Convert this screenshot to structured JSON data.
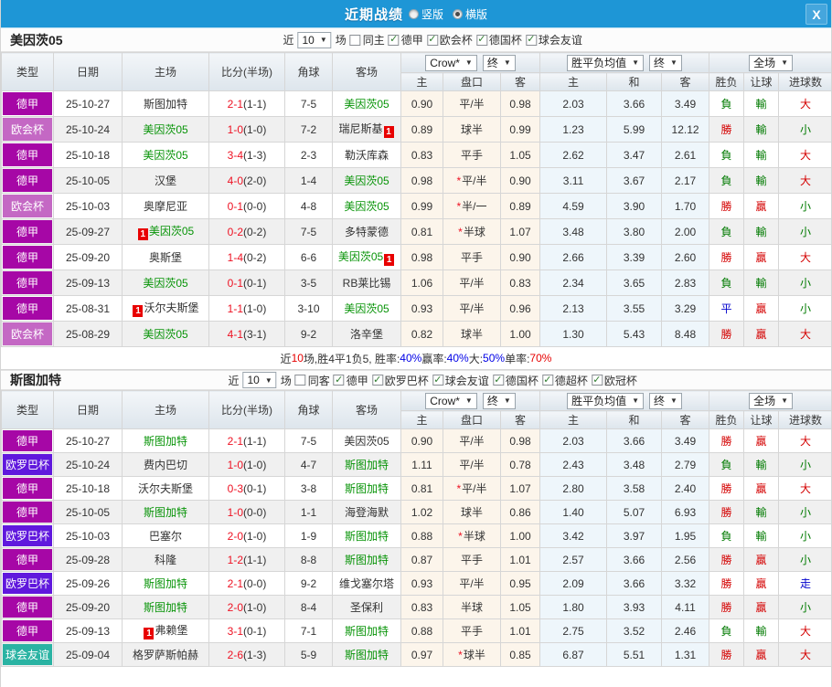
{
  "topbar": {
    "title": "近期战绩",
    "radios": [
      {
        "label": "竖版",
        "selected": false
      },
      {
        "label": "横版",
        "selected": true
      }
    ],
    "close_label": "X"
  },
  "table_headers": {
    "cols": [
      "类型",
      "日期",
      "主场",
      "比分(半场)",
      "角球",
      "客场"
    ],
    "sub": [
      "主",
      "盘口",
      "客",
      "主",
      "和",
      "客",
      "胜负",
      "让球",
      "进球数"
    ],
    "selects": {
      "asian": [
        "Crow*",
        "终"
      ],
      "euro": [
        "胜平负均值",
        "终"
      ],
      "scope": [
        "全场"
      ]
    }
  },
  "league_colors": {
    "德甲": "#a607a6",
    "欧会杯": "#c468c4",
    "欧罗巴杯": "#6018dd",
    "球会友谊": "#2ab3a3"
  },
  "result_colors": {
    "r": "#d40000",
    "g": "#007a00",
    "b": "#0000cc"
  },
  "accent_colors": {
    "topbar_blue": "#1e96d6",
    "score_red": "#ee1122",
    "team_green": "#089408"
  },
  "sections": [
    {
      "team": "美因茨05",
      "filter": {
        "near": "近",
        "count": "10",
        "unit": "场",
        "same": {
          "label": "同主",
          "checked": false
        },
        "leagues": [
          {
            "label": "德甲",
            "checked": true
          },
          {
            "label": "欧会杯",
            "checked": true
          },
          {
            "label": "德国杯",
            "checked": true
          },
          {
            "label": "球会友谊",
            "checked": true
          }
        ]
      },
      "rows": [
        {
          "league": "德甲",
          "date": "25-10-27",
          "home": "斯图加特",
          "home_green": false,
          "home_card": false,
          "score": "2-1",
          "half": "1-1",
          "corners": "7-5",
          "away": "美因茨05",
          "away_green": true,
          "away_card": false,
          "asian": [
            "0.90",
            "平/半",
            "0.98"
          ],
          "star": false,
          "euro": [
            "2.03",
            "3.66",
            "3.49"
          ],
          "wdl": [
            "負",
            "g"
          ],
          "hcp": [
            "輸",
            "g"
          ],
          "size": [
            "大",
            "r"
          ]
        },
        {
          "league": "欧会杯",
          "date": "25-10-24",
          "home": "美因茨05",
          "home_green": true,
          "home_card": false,
          "score": "1-0",
          "half": "1-0",
          "corners": "7-2",
          "away": "瑞尼斯基",
          "away_green": false,
          "away_card": true,
          "asian": [
            "0.89",
            "球半",
            "0.99"
          ],
          "star": false,
          "euro": [
            "1.23",
            "5.99",
            "12.12"
          ],
          "wdl": [
            "勝",
            "r"
          ],
          "hcp": [
            "輸",
            "g"
          ],
          "size": [
            "小",
            "g"
          ]
        },
        {
          "league": "德甲",
          "date": "25-10-18",
          "home": "美因茨05",
          "home_green": true,
          "home_card": false,
          "score": "3-4",
          "half": "1-3",
          "corners": "2-3",
          "away": "勒沃库森",
          "away_green": false,
          "away_card": false,
          "asian": [
            "0.83",
            "平手",
            "1.05"
          ],
          "star": false,
          "euro": [
            "2.62",
            "3.47",
            "2.61"
          ],
          "wdl": [
            "負",
            "g"
          ],
          "hcp": [
            "輸",
            "g"
          ],
          "size": [
            "大",
            "r"
          ]
        },
        {
          "league": "德甲",
          "date": "25-10-05",
          "home": "汉堡",
          "home_green": false,
          "home_card": false,
          "score": "4-0",
          "half": "2-0",
          "corners": "1-4",
          "away": "美因茨05",
          "away_green": true,
          "away_card": false,
          "asian": [
            "0.98",
            "平/半",
            "0.90"
          ],
          "star": true,
          "euro": [
            "3.11",
            "3.67",
            "2.17"
          ],
          "wdl": [
            "負",
            "g"
          ],
          "hcp": [
            "輸",
            "g"
          ],
          "size": [
            "大",
            "r"
          ]
        },
        {
          "league": "欧会杯",
          "date": "25-10-03",
          "home": "奥摩尼亚",
          "home_green": false,
          "home_card": false,
          "score": "0-1",
          "half": "0-0",
          "corners": "4-8",
          "away": "美因茨05",
          "away_green": true,
          "away_card": false,
          "asian": [
            "0.99",
            "半/一",
            "0.89"
          ],
          "star": true,
          "euro": [
            "4.59",
            "3.90",
            "1.70"
          ],
          "wdl": [
            "勝",
            "r"
          ],
          "hcp": [
            "贏",
            "r"
          ],
          "size": [
            "小",
            "g"
          ]
        },
        {
          "league": "德甲",
          "date": "25-09-27",
          "home": "美因茨05",
          "home_green": true,
          "home_card": true,
          "score": "0-2",
          "half": "0-2",
          "corners": "7-5",
          "away": "多特蒙德",
          "away_green": false,
          "away_card": false,
          "asian": [
            "0.81",
            "半球",
            "1.07"
          ],
          "star": true,
          "euro": [
            "3.48",
            "3.80",
            "2.00"
          ],
          "wdl": [
            "負",
            "g"
          ],
          "hcp": [
            "輸",
            "g"
          ],
          "size": [
            "小",
            "g"
          ]
        },
        {
          "league": "德甲",
          "date": "25-09-20",
          "home": "奥斯堡",
          "home_green": false,
          "home_card": false,
          "score": "1-4",
          "half": "0-2",
          "corners": "6-6",
          "away": "美因茨05",
          "away_green": true,
          "away_card": true,
          "asian": [
            "0.98",
            "平手",
            "0.90"
          ],
          "star": false,
          "euro": [
            "2.66",
            "3.39",
            "2.60"
          ],
          "wdl": [
            "勝",
            "r"
          ],
          "hcp": [
            "贏",
            "r"
          ],
          "size": [
            "大",
            "r"
          ]
        },
        {
          "league": "德甲",
          "date": "25-09-13",
          "home": "美因茨05",
          "home_green": true,
          "home_card": false,
          "score": "0-1",
          "half": "0-1",
          "corners": "3-5",
          "away": "RB莱比锡",
          "away_green": false,
          "away_card": false,
          "asian": [
            "1.06",
            "平/半",
            "0.83"
          ],
          "star": false,
          "euro": [
            "2.34",
            "3.65",
            "2.83"
          ],
          "wdl": [
            "負",
            "g"
          ],
          "hcp": [
            "輸",
            "g"
          ],
          "size": [
            "小",
            "g"
          ]
        },
        {
          "league": "德甲",
          "date": "25-08-31",
          "home": "沃尔夫斯堡",
          "home_green": false,
          "home_card": true,
          "score": "1-1",
          "half": "1-0",
          "corners": "3-10",
          "away": "美因茨05",
          "away_green": true,
          "away_card": false,
          "asian": [
            "0.93",
            "平/半",
            "0.96"
          ],
          "star": false,
          "euro": [
            "2.13",
            "3.55",
            "3.29"
          ],
          "wdl": [
            "平",
            "b"
          ],
          "hcp": [
            "贏",
            "r"
          ],
          "size": [
            "小",
            "g"
          ]
        },
        {
          "league": "欧会杯",
          "date": "25-08-29",
          "home": "美因茨05",
          "home_green": true,
          "home_card": false,
          "score": "4-1",
          "half": "3-1",
          "corners": "9-2",
          "away": "洛辛堡",
          "away_green": false,
          "away_card": false,
          "asian": [
            "0.82",
            "球半",
            "1.00"
          ],
          "star": false,
          "euro": [
            "1.30",
            "5.43",
            "8.48"
          ],
          "wdl": [
            "勝",
            "r"
          ],
          "hcp": [
            "贏",
            "r"
          ],
          "size": [
            "大",
            "r"
          ]
        }
      ],
      "summary": [
        {
          "text": "近",
          "color": "#333333"
        },
        {
          "text": "10",
          "color": "#e60000"
        },
        {
          "text": "场,胜4平1负5, 胜率:",
          "color": "#333333"
        },
        {
          "text": "40%",
          "color": "#0000e6"
        },
        {
          "text": " 赢率:",
          "color": "#333333"
        },
        {
          "text": "40%",
          "color": "#0000e6"
        },
        {
          "text": " 大:",
          "color": "#333333"
        },
        {
          "text": "50%",
          "color": "#0000e6"
        },
        {
          "text": " 单率:",
          "color": "#333333"
        },
        {
          "text": "70%",
          "color": "#e60000"
        }
      ]
    },
    {
      "team": "斯图加特",
      "filter": {
        "near": "近",
        "count": "10",
        "unit": "场",
        "same": {
          "label": "同客",
          "checked": false
        },
        "leagues": [
          {
            "label": "德甲",
            "checked": true
          },
          {
            "label": "欧罗巴杯",
            "checked": true
          },
          {
            "label": "球会友谊",
            "checked": true
          },
          {
            "label": "德国杯",
            "checked": true
          },
          {
            "label": "德超杯",
            "checked": true
          },
          {
            "label": "欧冠杯",
            "checked": true
          }
        ]
      },
      "rows": [
        {
          "league": "德甲",
          "date": "25-10-27",
          "home": "斯图加特",
          "home_green": true,
          "home_card": false,
          "score": "2-1",
          "half": "1-1",
          "corners": "7-5",
          "away": "美因茨05",
          "away_green": false,
          "away_card": false,
          "asian": [
            "0.90",
            "平/半",
            "0.98"
          ],
          "star": false,
          "euro": [
            "2.03",
            "3.66",
            "3.49"
          ],
          "wdl": [
            "勝",
            "r"
          ],
          "hcp": [
            "贏",
            "r"
          ],
          "size": [
            "大",
            "r"
          ]
        },
        {
          "league": "欧罗巴杯",
          "date": "25-10-24",
          "home": "费内巴切",
          "home_green": false,
          "home_card": false,
          "score": "1-0",
          "half": "1-0",
          "corners": "4-7",
          "away": "斯图加特",
          "away_green": true,
          "away_card": false,
          "asian": [
            "1.11",
            "平/半",
            "0.78"
          ],
          "star": false,
          "euro": [
            "2.43",
            "3.48",
            "2.79"
          ],
          "wdl": [
            "負",
            "g"
          ],
          "hcp": [
            "輸",
            "g"
          ],
          "size": [
            "小",
            "g"
          ]
        },
        {
          "league": "德甲",
          "date": "25-10-18",
          "home": "沃尔夫斯堡",
          "home_green": false,
          "home_card": false,
          "score": "0-3",
          "half": "0-1",
          "corners": "3-8",
          "away": "斯图加特",
          "away_green": true,
          "away_card": false,
          "asian": [
            "0.81",
            "平/半",
            "1.07"
          ],
          "star": true,
          "euro": [
            "2.80",
            "3.58",
            "2.40"
          ],
          "wdl": [
            "勝",
            "r"
          ],
          "hcp": [
            "贏",
            "r"
          ],
          "size": [
            "大",
            "r"
          ]
        },
        {
          "league": "德甲",
          "date": "25-10-05",
          "home": "斯图加特",
          "home_green": true,
          "home_card": false,
          "score": "1-0",
          "half": "0-0",
          "corners": "1-1",
          "away": "海登海默",
          "away_green": false,
          "away_card": false,
          "asian": [
            "1.02",
            "球半",
            "0.86"
          ],
          "star": false,
          "euro": [
            "1.40",
            "5.07",
            "6.93"
          ],
          "wdl": [
            "勝",
            "r"
          ],
          "hcp": [
            "輸",
            "g"
          ],
          "size": [
            "小",
            "g"
          ]
        },
        {
          "league": "欧罗巴杯",
          "date": "25-10-03",
          "home": "巴塞尔",
          "home_green": false,
          "home_card": false,
          "score": "2-0",
          "half": "1-0",
          "corners": "1-9",
          "away": "斯图加特",
          "away_green": true,
          "away_card": false,
          "asian": [
            "0.88",
            "半球",
            "1.00"
          ],
          "star": true,
          "euro": [
            "3.42",
            "3.97",
            "1.95"
          ],
          "wdl": [
            "負",
            "g"
          ],
          "hcp": [
            "輸",
            "g"
          ],
          "size": [
            "小",
            "g"
          ]
        },
        {
          "league": "德甲",
          "date": "25-09-28",
          "home": "科隆",
          "home_green": false,
          "home_card": false,
          "score": "1-2",
          "half": "1-1",
          "corners": "8-8",
          "away": "斯图加特",
          "away_green": true,
          "away_card": false,
          "asian": [
            "0.87",
            "平手",
            "1.01"
          ],
          "star": false,
          "euro": [
            "2.57",
            "3.66",
            "2.56"
          ],
          "wdl": [
            "勝",
            "r"
          ],
          "hcp": [
            "贏",
            "r"
          ],
          "size": [
            "小",
            "g"
          ]
        },
        {
          "league": "欧罗巴杯",
          "date": "25-09-26",
          "home": "斯图加特",
          "home_green": true,
          "home_card": false,
          "score": "2-1",
          "half": "0-0",
          "corners": "9-2",
          "away": "维戈塞尔塔",
          "away_green": false,
          "away_card": false,
          "asian": [
            "0.93",
            "平/半",
            "0.95"
          ],
          "star": false,
          "euro": [
            "2.09",
            "3.66",
            "3.32"
          ],
          "wdl": [
            "勝",
            "r"
          ],
          "hcp": [
            "贏",
            "r"
          ],
          "size": [
            "走",
            "b"
          ]
        },
        {
          "league": "德甲",
          "date": "25-09-20",
          "home": "斯图加特",
          "home_green": true,
          "home_card": false,
          "score": "2-0",
          "half": "1-0",
          "corners": "8-4",
          "away": "圣保利",
          "away_green": false,
          "away_card": false,
          "asian": [
            "0.83",
            "半球",
            "1.05"
          ],
          "star": false,
          "euro": [
            "1.80",
            "3.93",
            "4.11"
          ],
          "wdl": [
            "勝",
            "r"
          ],
          "hcp": [
            "贏",
            "r"
          ],
          "size": [
            "小",
            "g"
          ]
        },
        {
          "league": "德甲",
          "date": "25-09-13",
          "home": "弗赖堡",
          "home_green": false,
          "home_card": true,
          "score": "3-1",
          "half": "0-1",
          "corners": "7-1",
          "away": "斯图加特",
          "away_green": true,
          "away_card": false,
          "asian": [
            "0.88",
            "平手",
            "1.01"
          ],
          "star": false,
          "euro": [
            "2.75",
            "3.52",
            "2.46"
          ],
          "wdl": [
            "負",
            "g"
          ],
          "hcp": [
            "輸",
            "g"
          ],
          "size": [
            "大",
            "r"
          ]
        },
        {
          "league": "球会友谊",
          "date": "25-09-04",
          "home": "格罗萨斯帕赫",
          "home_green": false,
          "home_card": false,
          "score": "2-6",
          "half": "1-3",
          "corners": "5-9",
          "away": "斯图加特",
          "away_green": true,
          "away_card": false,
          "asian": [
            "0.97",
            "球半",
            "0.85"
          ],
          "star": true,
          "euro": [
            "6.87",
            "5.51",
            "1.31"
          ],
          "wdl": [
            "勝",
            "r"
          ],
          "hcp": [
            "贏",
            "r"
          ],
          "size": [
            "大",
            "r"
          ]
        }
      ]
    }
  ]
}
